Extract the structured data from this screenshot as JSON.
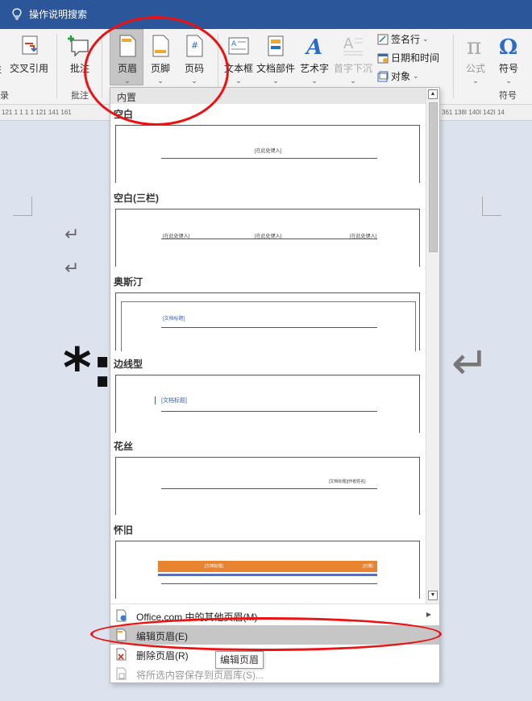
{
  "tell_me": {
    "label": "操作说明搜索"
  },
  "ribbon": {
    "cross_ref": "交叉引用",
    "comment": "批注",
    "header": "页眉",
    "footer": "页脚",
    "page_number": "页码",
    "text_box": "文本框",
    "quick_parts": "文档部件",
    "word_art": "艺术字",
    "drop_cap": "首字下沉",
    "signature_line": "签名行",
    "date_time": "日期和时间",
    "object": "对象",
    "equation": "公式",
    "symbol": "符号",
    "group_comments": "批注",
    "group_symbols": "符号",
    "left_partial_btn": "E",
    "left_partial_group": "录"
  },
  "ruler": {
    "left_ticks": "121 1 1 1 1 121 141 161",
    "right_ticks": "361 138I 140I 142I 14"
  },
  "gallery": {
    "section_title": "内置",
    "categories": [
      {
        "name": "空白",
        "fields": [
          "[在此处键入]"
        ]
      },
      {
        "name": "空白(三栏)",
        "fields": [
          "[在此处键入]",
          "[在此处键入]",
          "[在此处键入]"
        ]
      },
      {
        "name": "奥斯汀",
        "fields": [
          "[文档标题]"
        ]
      },
      {
        "name": "边线型",
        "fields": [
          "[文档标题]"
        ]
      },
      {
        "name": "花丝",
        "fields": [
          "[文档标题][作者姓名]"
        ]
      },
      {
        "name": "怀旧",
        "fields": [
          "[文档标题]",
          "[日期]"
        ]
      }
    ],
    "scroll_up": "▲",
    "scroll_down": "▼"
  },
  "menu": {
    "more_headers": "Office.com 中的其他页眉(M)",
    "edit_header": "编辑页眉(E)",
    "remove_header": "删除页眉(R)",
    "save_selection": "将所选内容保存到页眉库(S)..."
  },
  "tooltip": "编辑页眉",
  "colors": {
    "title_bar": "#2b579a",
    "annotation": "#e11111",
    "retro_orange": "#e8832f",
    "retro_blue": "#5b6fb5"
  }
}
